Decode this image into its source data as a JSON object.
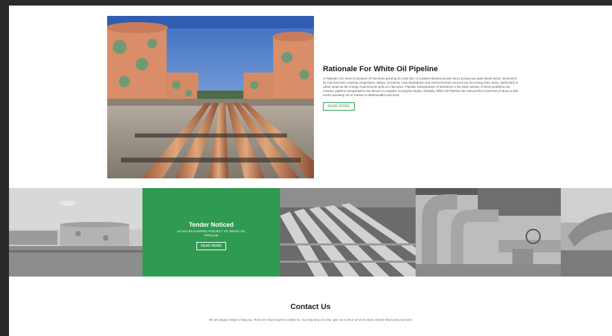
{
  "rationale": {
    "title": "Rationale For White Oil Pipeline",
    "body": "In Pakistan, the need to transport oil has been growing at a fast rate, to sustain industrial growth and a prosperous agricultural sector. Movement by road has been causing congestions, delays, accidents, road degradation and environmental concerns are becoming more acute, particularly in urban areas as the energy requirements grow at a fast pace. Pipeline transportation of petroleum is the ideal solution of these problems. By contrast, pipeline transportation has almost no negative ecological impact. Similarly, White Oil Pipeline has reduced the movement of about 4,000 trucks operating out of Karachi to Mahmoodkot and back.",
    "button": "READ MORE"
  },
  "tender": {
    "title": "Tender Noticed",
    "subtitle": "SCADA REVAMPING PROJECT OF WHITE OIL PIPELINE",
    "button": "READ MORE"
  },
  "contact": {
    "title": "Contact Us",
    "body": "We are always ready to help you. There are many ways to contact us. You may drop us a line, give us a call or send an email, choose what suits you most."
  },
  "colors": {
    "accent": "#2e9b50",
    "page_bg": "#ffffff",
    "outer_bg": "#2a2a2a"
  }
}
